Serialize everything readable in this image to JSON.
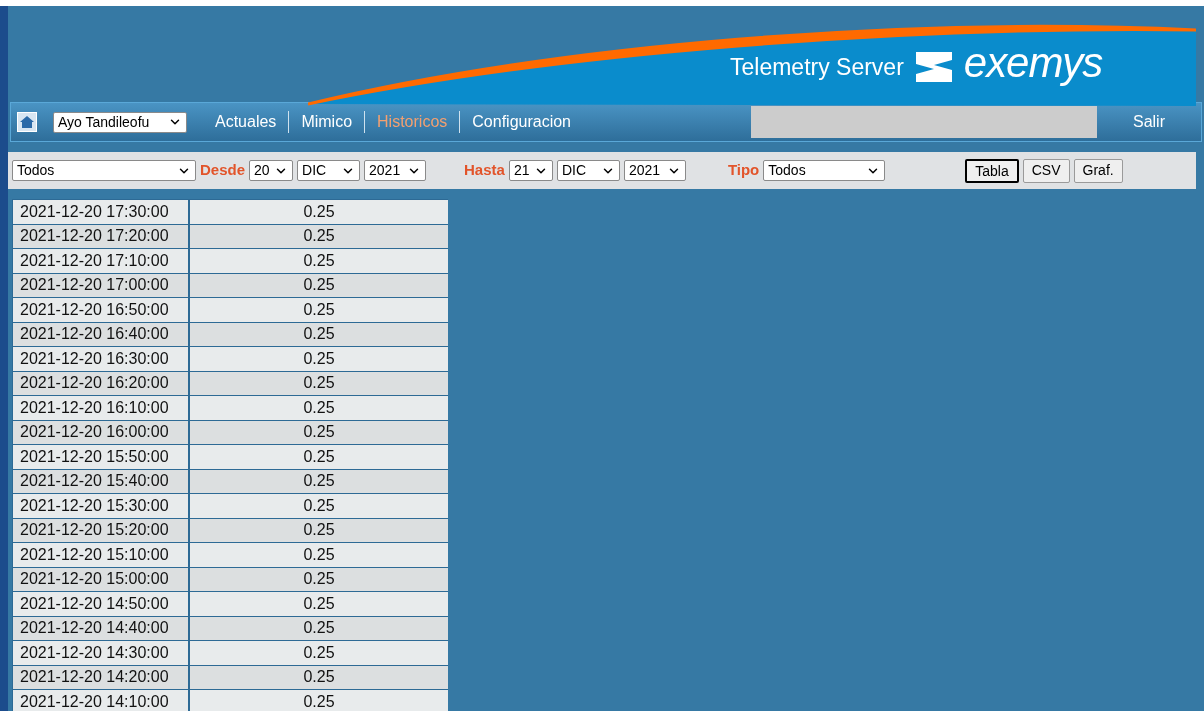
{
  "banner": {
    "product": "Telemetry Server",
    "brand": "exemys"
  },
  "nav": {
    "site_select": "Ayo Tandileofu",
    "tabs": [
      {
        "label": "Actuales",
        "selected": false
      },
      {
        "label": "Mimico",
        "selected": false
      },
      {
        "label": "Historicos",
        "selected": true
      },
      {
        "label": "Configuracion",
        "selected": false
      }
    ],
    "logout": "Salir"
  },
  "filters": {
    "variable": "Todos",
    "from_label": "Desde",
    "from_day": "20",
    "from_month": "DIC",
    "from_year": "2021",
    "to_label": "Hasta",
    "to_day": "21",
    "to_month": "DIC",
    "to_year": "2021",
    "type_label": "Tipo",
    "type": "Todos",
    "views": [
      {
        "label": "Tabla",
        "selected": true
      },
      {
        "label": "CSV",
        "selected": false
      },
      {
        "label": "Graf.",
        "selected": false
      }
    ]
  },
  "table": {
    "rows": [
      [
        "2021-12-20 17:30:00",
        "0.25"
      ],
      [
        "2021-12-20 17:20:00",
        "0.25"
      ],
      [
        "2021-12-20 17:10:00",
        "0.25"
      ],
      [
        "2021-12-20 17:00:00",
        "0.25"
      ],
      [
        "2021-12-20 16:50:00",
        "0.25"
      ],
      [
        "2021-12-20 16:40:00",
        "0.25"
      ],
      [
        "2021-12-20 16:30:00",
        "0.25"
      ],
      [
        "2021-12-20 16:20:00",
        "0.25"
      ],
      [
        "2021-12-20 16:10:00",
        "0.25"
      ],
      [
        "2021-12-20 16:00:00",
        "0.25"
      ],
      [
        "2021-12-20 15:50:00",
        "0.25"
      ],
      [
        "2021-12-20 15:40:00",
        "0.25"
      ],
      [
        "2021-12-20 15:30:00",
        "0.25"
      ],
      [
        "2021-12-20 15:20:00",
        "0.25"
      ],
      [
        "2021-12-20 15:10:00",
        "0.25"
      ],
      [
        "2021-12-20 15:00:00",
        "0.25"
      ],
      [
        "2021-12-20 14:50:00",
        "0.25"
      ],
      [
        "2021-12-20 14:40:00",
        "0.25"
      ],
      [
        "2021-12-20 14:30:00",
        "0.25"
      ],
      [
        "2021-12-20 14:20:00",
        "0.25"
      ],
      [
        "2021-12-20 14:10:00",
        "0.25"
      ]
    ]
  }
}
